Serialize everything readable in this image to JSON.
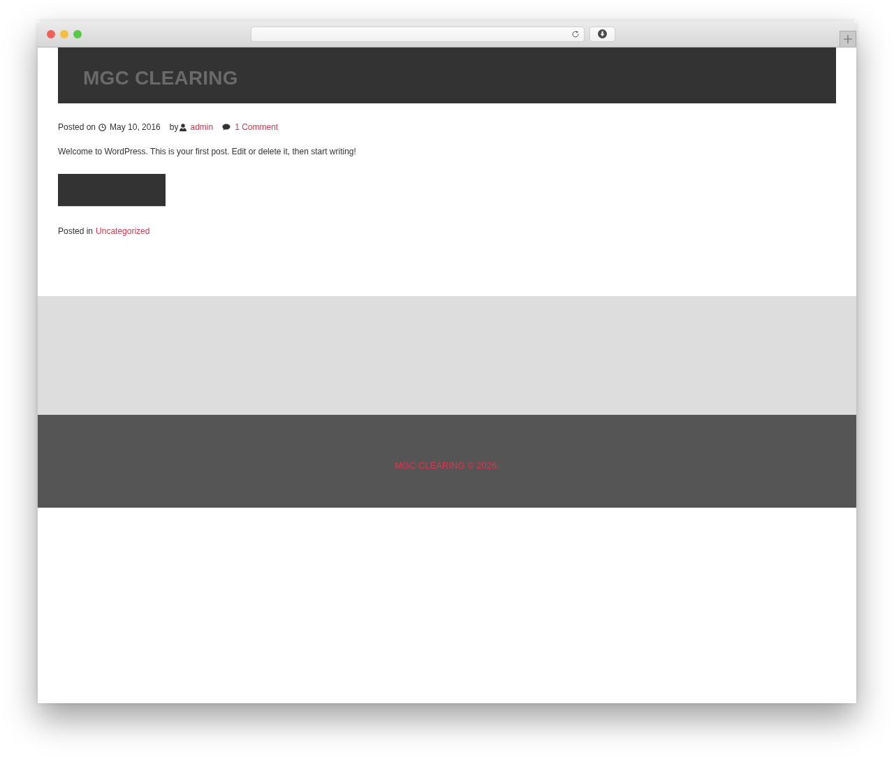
{
  "site": {
    "title": "MGC CLEARING"
  },
  "post": {
    "meta": {
      "posted_on_label": "Posted on",
      "date": "May 10, 2016",
      "by_label": "by",
      "author": "admin",
      "comments": "1 Comment"
    },
    "body": "Welcome to WordPress. This is your first post. Edit or delete it, then start writing!",
    "category_label": "Posted in",
    "category": "Uncategorized"
  },
  "footer": {
    "copyright": "MGC CLEARING © 2026."
  }
}
